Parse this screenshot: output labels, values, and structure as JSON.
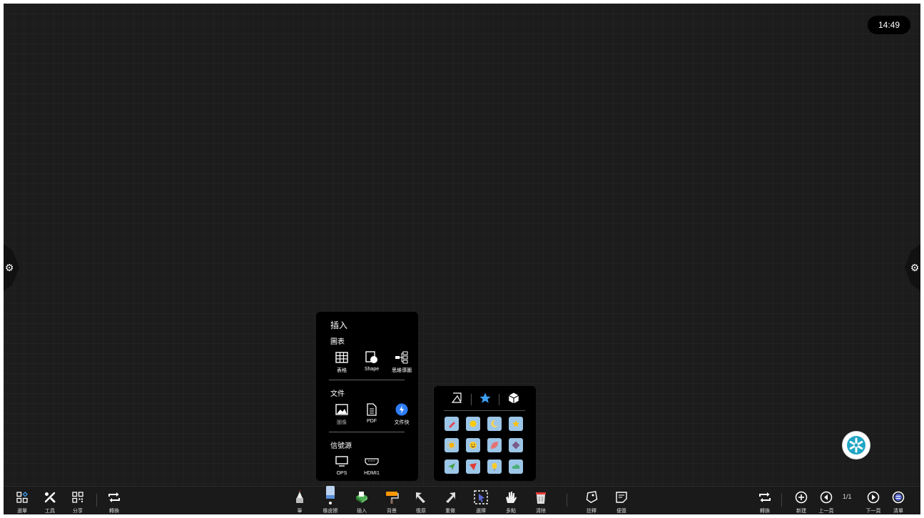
{
  "clock": "14:49",
  "insert_panel": {
    "title": "插入",
    "chart_section": {
      "title": "圖表",
      "items": [
        {
          "label": "表格",
          "icon": "table-icon"
        },
        {
          "label": "Shape",
          "icon": "shape-icon"
        },
        {
          "label": "思維導圖",
          "icon": "mindmap-icon"
        }
      ]
    },
    "file_section": {
      "title": "文件",
      "items": [
        {
          "label": "圖像",
          "icon": "image-icon"
        },
        {
          "label": "PDF",
          "icon": "pdf-icon"
        },
        {
          "label": "文件快",
          "icon": "file-transfer-icon"
        }
      ]
    },
    "source_section": {
      "title": "信號源",
      "items": [
        {
          "label": "OPS",
          "icon": "monitor-icon"
        },
        {
          "label": "HDMI1",
          "icon": "hdmi-icon"
        }
      ]
    }
  },
  "shape_panel": {
    "tabs": [
      "2d-shape-icon",
      "star-icon",
      "cube-icon"
    ],
    "active_tab": "star-icon",
    "tiles": [
      "pencil-icon",
      "sun-icon",
      "moon-icon",
      "star-icon",
      "sunny-icon",
      "smile-icon",
      "leaf-icon",
      "diamond-icon",
      "paper-plane-icon",
      "arrow-icon",
      "balloon-icon",
      "cloud-icon"
    ]
  },
  "toolbar": {
    "left": [
      {
        "label": "選單",
        "icon": "menu-grid-icon"
      },
      {
        "label": "工具",
        "icon": "tools-icon"
      },
      {
        "label": "分享",
        "icon": "qr-code-icon"
      },
      {
        "label": "轉換",
        "icon": "swap-icon"
      }
    ],
    "center": [
      {
        "label": "筆",
        "icon": "pen-icon"
      },
      {
        "label": "橡皮擦",
        "icon": "eraser-icon"
      },
      {
        "label": "插入",
        "icon": "insert-icon"
      },
      {
        "label": "背景",
        "icon": "paint-roller-icon"
      },
      {
        "label": "復原",
        "icon": "undo-icon"
      },
      {
        "label": "重做",
        "icon": "redo-icon"
      },
      {
        "label": "選擇",
        "icon": "select-icon"
      },
      {
        "label": "多點",
        "icon": "multi-touch-icon"
      },
      {
        "label": "清除",
        "icon": "trash-icon"
      },
      {
        "label": "註釋",
        "icon": "annotate-icon"
      },
      {
        "label": "便簽",
        "icon": "sticky-note-icon"
      }
    ],
    "right": [
      {
        "label": "轉換",
        "icon": "swap-icon"
      },
      {
        "label": "新建",
        "icon": "add-page-icon"
      },
      {
        "label": "上一頁",
        "icon": "prev-page-icon"
      },
      {
        "label": "下一頁",
        "icon": "next-page-icon"
      },
      {
        "label": "清單",
        "icon": "list-icon"
      }
    ],
    "page_indicator": "1/1"
  },
  "colors": {
    "background": "#1c1c1c",
    "panel": "#000000",
    "accent": "#2f7df6",
    "tile": "#9cc6e8"
  }
}
